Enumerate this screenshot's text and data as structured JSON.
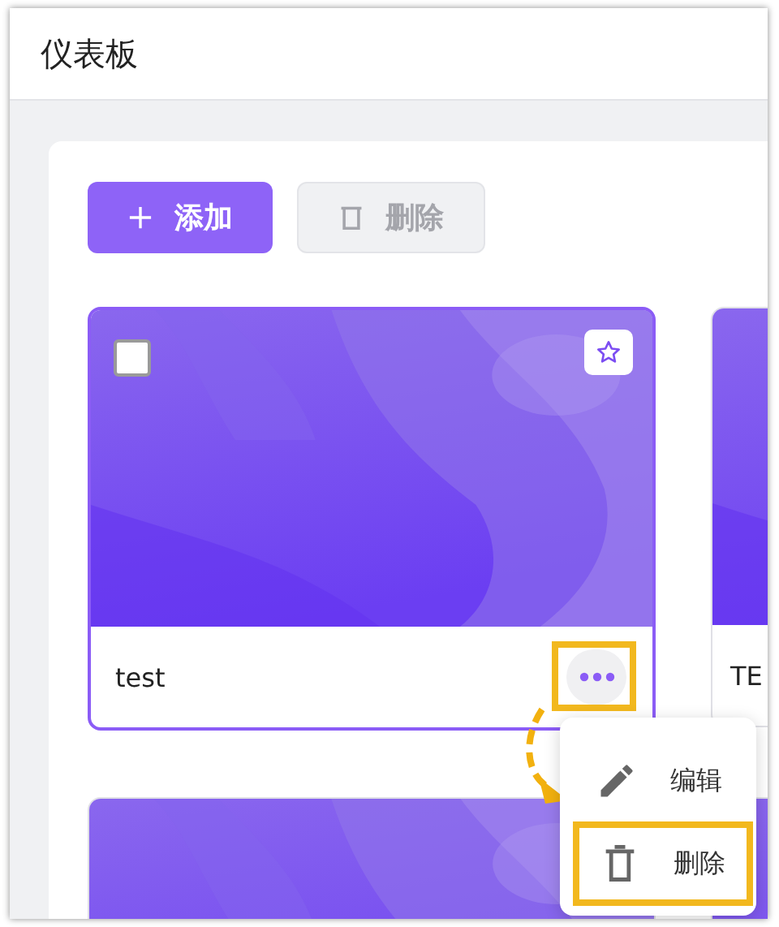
{
  "header": {
    "title": "仪表板"
  },
  "toolbar": {
    "buttons": [
      {
        "kind": "add",
        "label": "添加",
        "disabled": false
      },
      {
        "kind": "delete",
        "label": "删除",
        "disabled": true
      }
    ]
  },
  "cards": [
    {
      "title": "test",
      "hovered": true,
      "checked": false,
      "more_highlighted": true
    },
    {
      "title": "TE",
      "hovered": false
    },
    {
      "hovered": false
    },
    {
      "hovered": false
    }
  ],
  "menu": {
    "items": [
      {
        "kind": "edit",
        "label": "编辑",
        "highlighted": false
      },
      {
        "kind": "delete",
        "label": "删除",
        "highlighted": true
      }
    ]
  }
}
